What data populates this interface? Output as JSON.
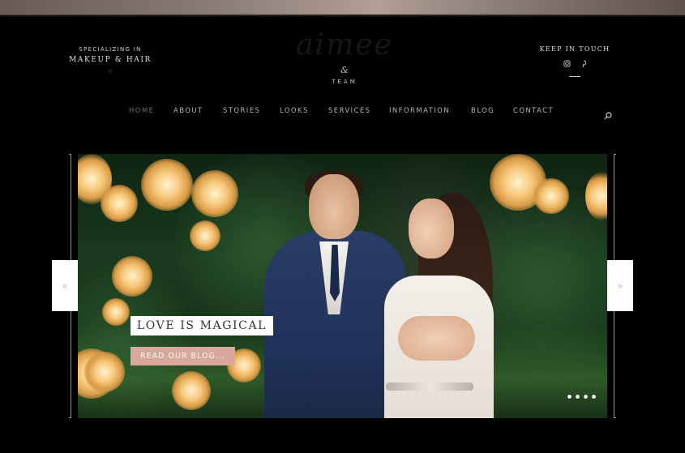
{
  "header": {
    "tagline_top": "SPECIALIZING IN",
    "tagline_bottom": "MAKEUP & HAIR",
    "logo_script": "aimee",
    "logo_amp": "&",
    "logo_team": "TEAM",
    "keep_in_touch": "KEEP IN TOUCH",
    "social_icons": [
      "instagram-icon",
      "pinterest-icon"
    ]
  },
  "nav": {
    "items": [
      {
        "label": "HOME",
        "active": true
      },
      {
        "label": "ABOUT",
        "active": false
      },
      {
        "label": "STORIES",
        "active": false
      },
      {
        "label": "LOOKS",
        "active": false
      },
      {
        "label": "SERVICES",
        "active": false
      },
      {
        "label": "INFORMATION",
        "active": false
      },
      {
        "label": "BLOG",
        "active": false
      },
      {
        "label": "CONTACT",
        "active": false
      }
    ],
    "search_icon": "search-icon"
  },
  "slider": {
    "caption": "LOVE IS MAGICAL",
    "cta_label": "READ OUR BLOG...",
    "prev_icon": "«",
    "next_icon": "»",
    "dot_count": 4,
    "active_dot": 0
  },
  "colors": {
    "background": "#000000",
    "cta": "#d9a89c",
    "top_band": "#b19e96"
  }
}
